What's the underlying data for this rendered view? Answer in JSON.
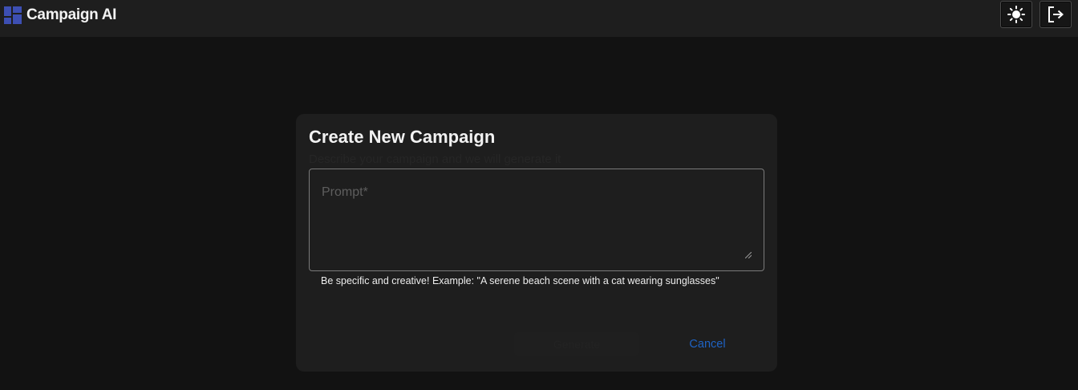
{
  "app": {
    "title": "Campaign AI",
    "logo_icon": "dashboard-icon",
    "logo_color": "#3d4fb3"
  },
  "toolbar": {
    "theme_icon": "sun-icon",
    "logout_icon": "logout-icon"
  },
  "dialog": {
    "title": "Create New Campaign",
    "subtitle": "Describe your campaign and we will generate it",
    "prompt": {
      "placeholder": "Prompt*",
      "value": ""
    },
    "helper_text": "Be specific and creative! Example: \"A serene beach scene with a cat wearing sunglasses\"",
    "generate_label": "Generate",
    "cancel_label": "Cancel",
    "accent_color": "#1e63c4"
  }
}
